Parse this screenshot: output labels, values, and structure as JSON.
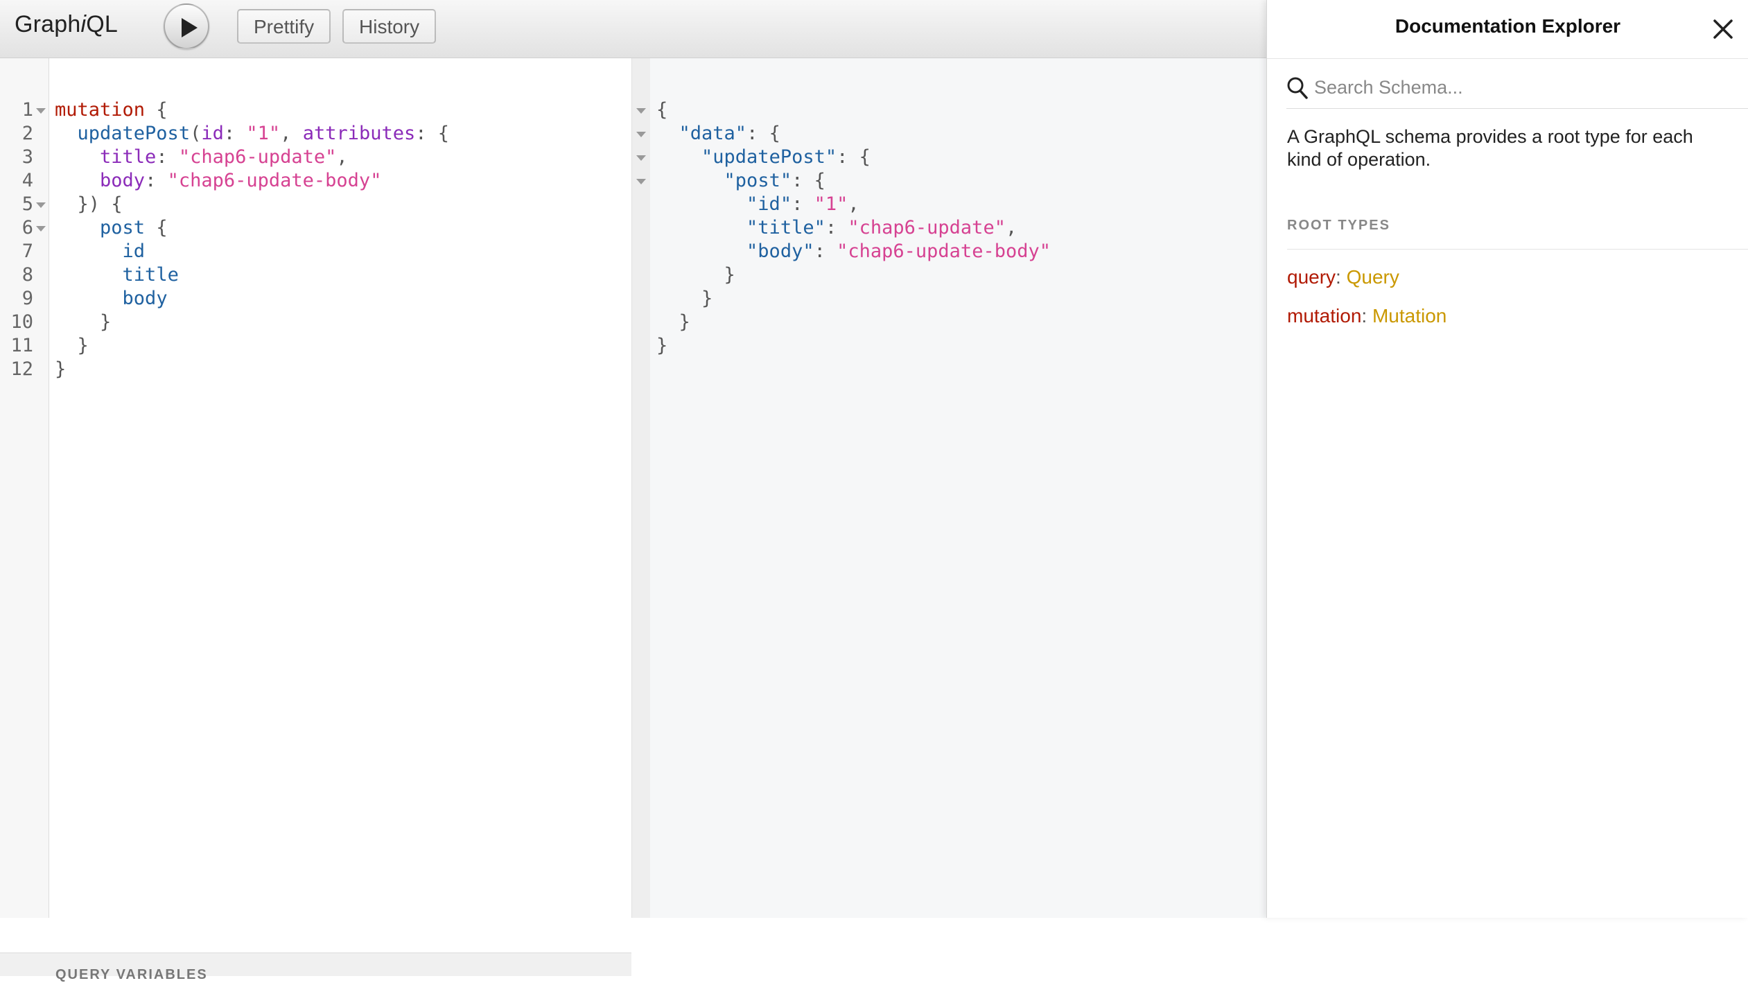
{
  "app": {
    "logo_prefix": "Graph",
    "logo_i": "i",
    "logo_suffix": "QL"
  },
  "toolbar": {
    "run_label": "Execute Query",
    "prettify_label": "Prettify",
    "history_label": "History"
  },
  "query_editor": {
    "line_numbers": [
      "1",
      "2",
      "3",
      "4",
      "5",
      "6",
      "7",
      "8",
      "9",
      "10",
      "11",
      "12"
    ],
    "lines": [
      "mutation {",
      "  updatePost(id: \"1\", attributes: {",
      "    title: \"chap6-update\",",
      "    body: \"chap6-update-body\"",
      "  }) {",
      "    post {",
      "      id",
      "      title",
      "      body",
      "    }",
      "  }",
      "}"
    ],
    "variables_label": "QUERY VARIABLES"
  },
  "result": {
    "lines": [
      "{",
      "  \"data\": {",
      "    \"updatePost\": {",
      "      \"post\": {",
      "        \"id\": \"1\",",
      "        \"title\": \"chap6-update\",",
      "        \"body\": \"chap6-update-body\"",
      "      }",
      "    }",
      "  }",
      "}"
    ]
  },
  "doc_explorer": {
    "title": "Documentation Explorer",
    "search_placeholder": "Search Schema...",
    "description": "A GraphQL schema provides a root type for each kind of operation.",
    "section_title": "ROOT TYPES",
    "root_types": [
      {
        "field": "query",
        "type": "Query"
      },
      {
        "field": "mutation",
        "type": "Mutation"
      }
    ]
  },
  "colors": {
    "keyword": "#b11a04",
    "string": "#d64292",
    "field": "#1f61a0",
    "attribute": "#8b2bb9",
    "type": "#ca9800"
  },
  "icons": [
    "play-icon",
    "close-icon",
    "search-icon",
    "fold-arrow-icon"
  ]
}
